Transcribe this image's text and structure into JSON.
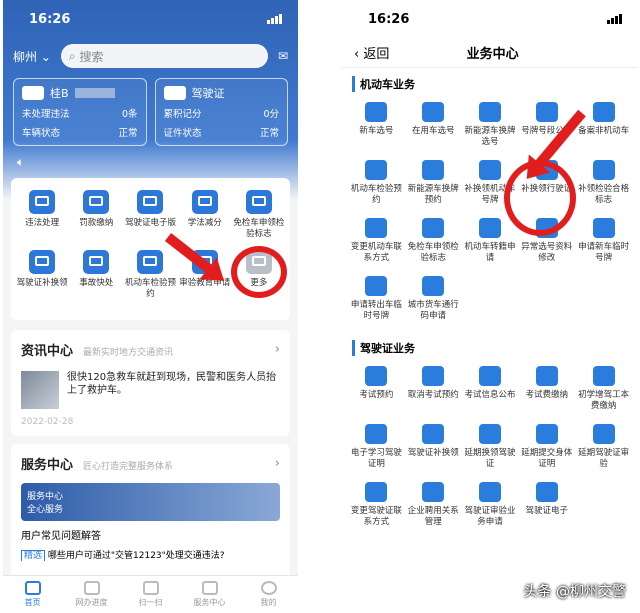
{
  "left": {
    "status_time": "16:26",
    "city": "柳州",
    "search_placeholder": "搜索",
    "car_card": {
      "plate": "桂B",
      "rows": [
        {
          "label": "未处理违法",
          "value": "0条"
        },
        {
          "label": "车辆状态",
          "value": "正常"
        }
      ]
    },
    "license_card": {
      "title": "驾驶证",
      "rows": [
        {
          "label": "累积记分",
          "value": "0分"
        },
        {
          "label": "证件状态",
          "value": "正常"
        }
      ]
    },
    "services": [
      "违法处理",
      "罚款缴纳",
      "驾驶证电子版",
      "学法减分",
      "免检车申领检验标志",
      "驾驶证补换领",
      "事故快处",
      "机动车检验预约",
      "审验教育申请",
      "更多"
    ],
    "news": {
      "title": "资讯中心",
      "subtitle": "最新实时地方交通资讯",
      "headline": "很快120急救车就赶到现场，民警和医务人员抬上了救护车。",
      "date": "2022-02-28"
    },
    "service_center": {
      "title": "服务中心",
      "subtitle": "匠心打造完整服务体系",
      "banner_tag": "服务中心",
      "banner_text": "全心服务",
      "faq": "用户常见问题解答",
      "tag": "精选",
      "faq2": "哪些用户可通过\"交管12123\"处理交通违法?"
    },
    "tabs": [
      "首页",
      "网办进度",
      "扫一扫",
      "服务中心",
      "我的"
    ]
  },
  "right": {
    "status_time": "16:26",
    "back": "返回",
    "title": "业务中心",
    "vehicle_header": "机动车业务",
    "vehicle_items": [
      "新车选号",
      "在用车选号",
      "新能源车换牌选号",
      "号牌号段公布",
      "备案非机动车",
      "机动车检验预约",
      "新能源车换牌预约",
      "补换领机动车号牌",
      "补换领行驶证",
      "补领检验合格标志",
      "变更机动车联系方式",
      "免检车申领检验标志",
      "机动车转籍申请",
      "异常选号资料修改",
      "申请新车临时号牌",
      "申请转出车临时号牌",
      "城市货车通行码申请"
    ],
    "license_header": "驾驶证业务",
    "license_items": [
      "考试预约",
      "取消考试预约",
      "考试信息公布",
      "考试费缴纳",
      "初学增驾工本费缴纳",
      "电子学习驾驶证明",
      "驾驶证补换领",
      "延期换领驾驶证",
      "延期提交身体证明",
      "延期驾驶证审验",
      "变更驾驶证联系方式",
      "企业聘用关系管理",
      "驾驶证审验业务申请",
      "驾驶证电子"
    ],
    "watermark": "头条 @柳州交警"
  }
}
